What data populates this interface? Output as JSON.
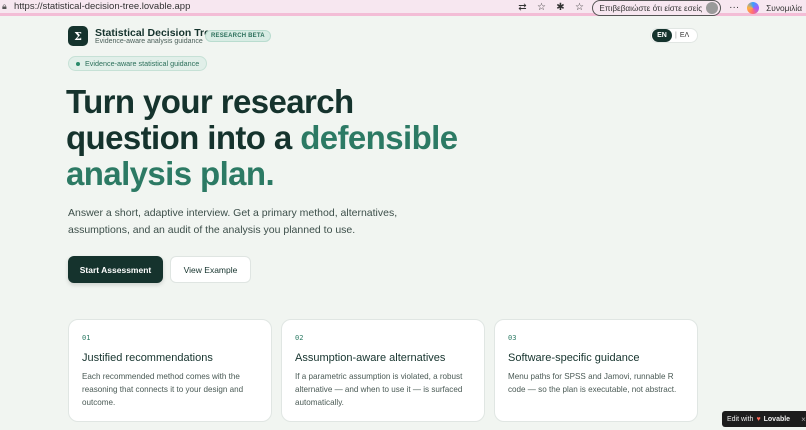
{
  "browser": {
    "url": "https://statistical-decision-tree.lovable.app",
    "signin_text": "Επιβεβαιώστε ότι είστε εσείς",
    "copilot_label": "Συνομιλία"
  },
  "header": {
    "logo_symbol": "Σ",
    "title": "Statistical Decision Tree",
    "subtitle": "Evidence-aware analysis guidance",
    "badge": "RESEARCH BETA",
    "lang_active": "EN",
    "lang_sep": "|",
    "lang_other": "ΕΛ"
  },
  "hero": {
    "pill": "Evidence-aware statistical guidance",
    "title_line1": "Turn your research",
    "title_line2_plain": "question into a ",
    "title_line2_accent": "defensible",
    "title_line3_accent": "analysis plan.",
    "description": "Answer a short, adaptive interview. Get a primary method, alternatives, assumptions, and an audit of the analysis you planned to use.",
    "primary_button": "Start Assessment",
    "secondary_button": "View Example"
  },
  "cards": [
    {
      "num": "01",
      "title": "Justified recommendations",
      "text": "Each recommended method comes with the reasoning that connects it to your design and outcome."
    },
    {
      "num": "02",
      "title": "Assumption-aware alternatives",
      "text": "If a parametric assumption is violated, a robust alternative — and when to use it — is surfaced automatically."
    },
    {
      "num": "03",
      "title": "Software-specific guidance",
      "text": "Menu paths for SPSS and Jamovi, runnable R code — so the plan is executable, not abstract."
    }
  ],
  "lovable_badge": {
    "prefix": "Edit with",
    "brand": "Lovable",
    "close": "×"
  },
  "colors": {
    "dark_green": "#15332d",
    "accent_green": "#2c7a64",
    "background": "#f1f5f1"
  }
}
